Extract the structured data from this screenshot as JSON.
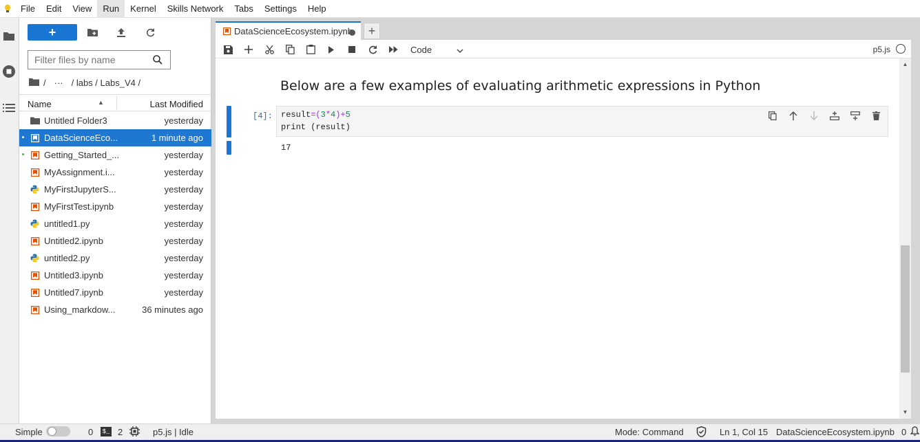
{
  "menu": [
    "File",
    "Edit",
    "View",
    "Run",
    "Kernel",
    "Skills Network",
    "Tabs",
    "Settings",
    "Help"
  ],
  "menu_active": "Run",
  "file_browser": {
    "new_label": "+",
    "search_placeholder": "Filter files by name",
    "breadcrumb": [
      "/",
      "···",
      "/ labs / Labs_V4 /"
    ],
    "col_name": "Name",
    "col_modified": "Last Modified",
    "files": [
      {
        "name": "Untitled Folder3",
        "modified": "yesterday",
        "type": "folder-icon",
        "selected": false,
        "running": false
      },
      {
        "name": "DataScienceEco...",
        "modified": "1 minute ago",
        "type": "notebook-icon",
        "selected": true,
        "running": true
      },
      {
        "name": "Getting_Started_...",
        "modified": "yesterday",
        "type": "notebook-icon",
        "selected": false,
        "running": true
      },
      {
        "name": "MyAssignment.i...",
        "modified": "yesterday",
        "type": "notebook-icon",
        "selected": false,
        "running": false
      },
      {
        "name": "MyFirstJupyterS...",
        "modified": "yesterday",
        "type": "python-icon",
        "selected": false,
        "running": false
      },
      {
        "name": "MyFirstTest.ipynb",
        "modified": "yesterday",
        "type": "notebook-icon",
        "selected": false,
        "running": false
      },
      {
        "name": "untitled1.py",
        "modified": "yesterday",
        "type": "python-icon",
        "selected": false,
        "running": false
      },
      {
        "name": "Untitled2.ipynb",
        "modified": "yesterday",
        "type": "notebook-icon",
        "selected": false,
        "running": false
      },
      {
        "name": "untitled2.py",
        "modified": "yesterday",
        "type": "python-icon",
        "selected": false,
        "running": false
      },
      {
        "name": "Untitled3.ipynb",
        "modified": "yesterday",
        "type": "notebook-icon",
        "selected": false,
        "running": false
      },
      {
        "name": "Untitled7.ipynb",
        "modified": "yesterday",
        "type": "notebook-icon",
        "selected": false,
        "running": false
      },
      {
        "name": "Using_markdow...",
        "modified": "36 minutes ago",
        "type": "notebook-icon",
        "selected": false,
        "running": false
      }
    ]
  },
  "tab": {
    "label": "DataScienceEcosystem.ipynb",
    "add_label": "+"
  },
  "notebook": {
    "cell_type": "Code",
    "kernel_name": "p5.js",
    "heading": "Below are a few examples of evaluating arithmetic expressions in Python",
    "prompt": "[4]:",
    "code_line1": {
      "a": "result",
      "b": "=(",
      "c": "3",
      "d": "*",
      "e": "4",
      "f": ")+",
      "g": "5"
    },
    "code_line2": "print (result)",
    "output": "17"
  },
  "status": {
    "mode_simple": "Simple",
    "terminals_count": "0",
    "kernels_count": "2",
    "kernel_state": "p5.js | Idle",
    "mode": "Mode: Command",
    "cursor": "Ln 1, Col 15",
    "filename": "DataScienceEcosystem.ipynb",
    "notifications": "0"
  },
  "colors": {
    "accent": "#1976d2",
    "notebook_icon": "#e65100",
    "python_icon": "#3572A5"
  }
}
